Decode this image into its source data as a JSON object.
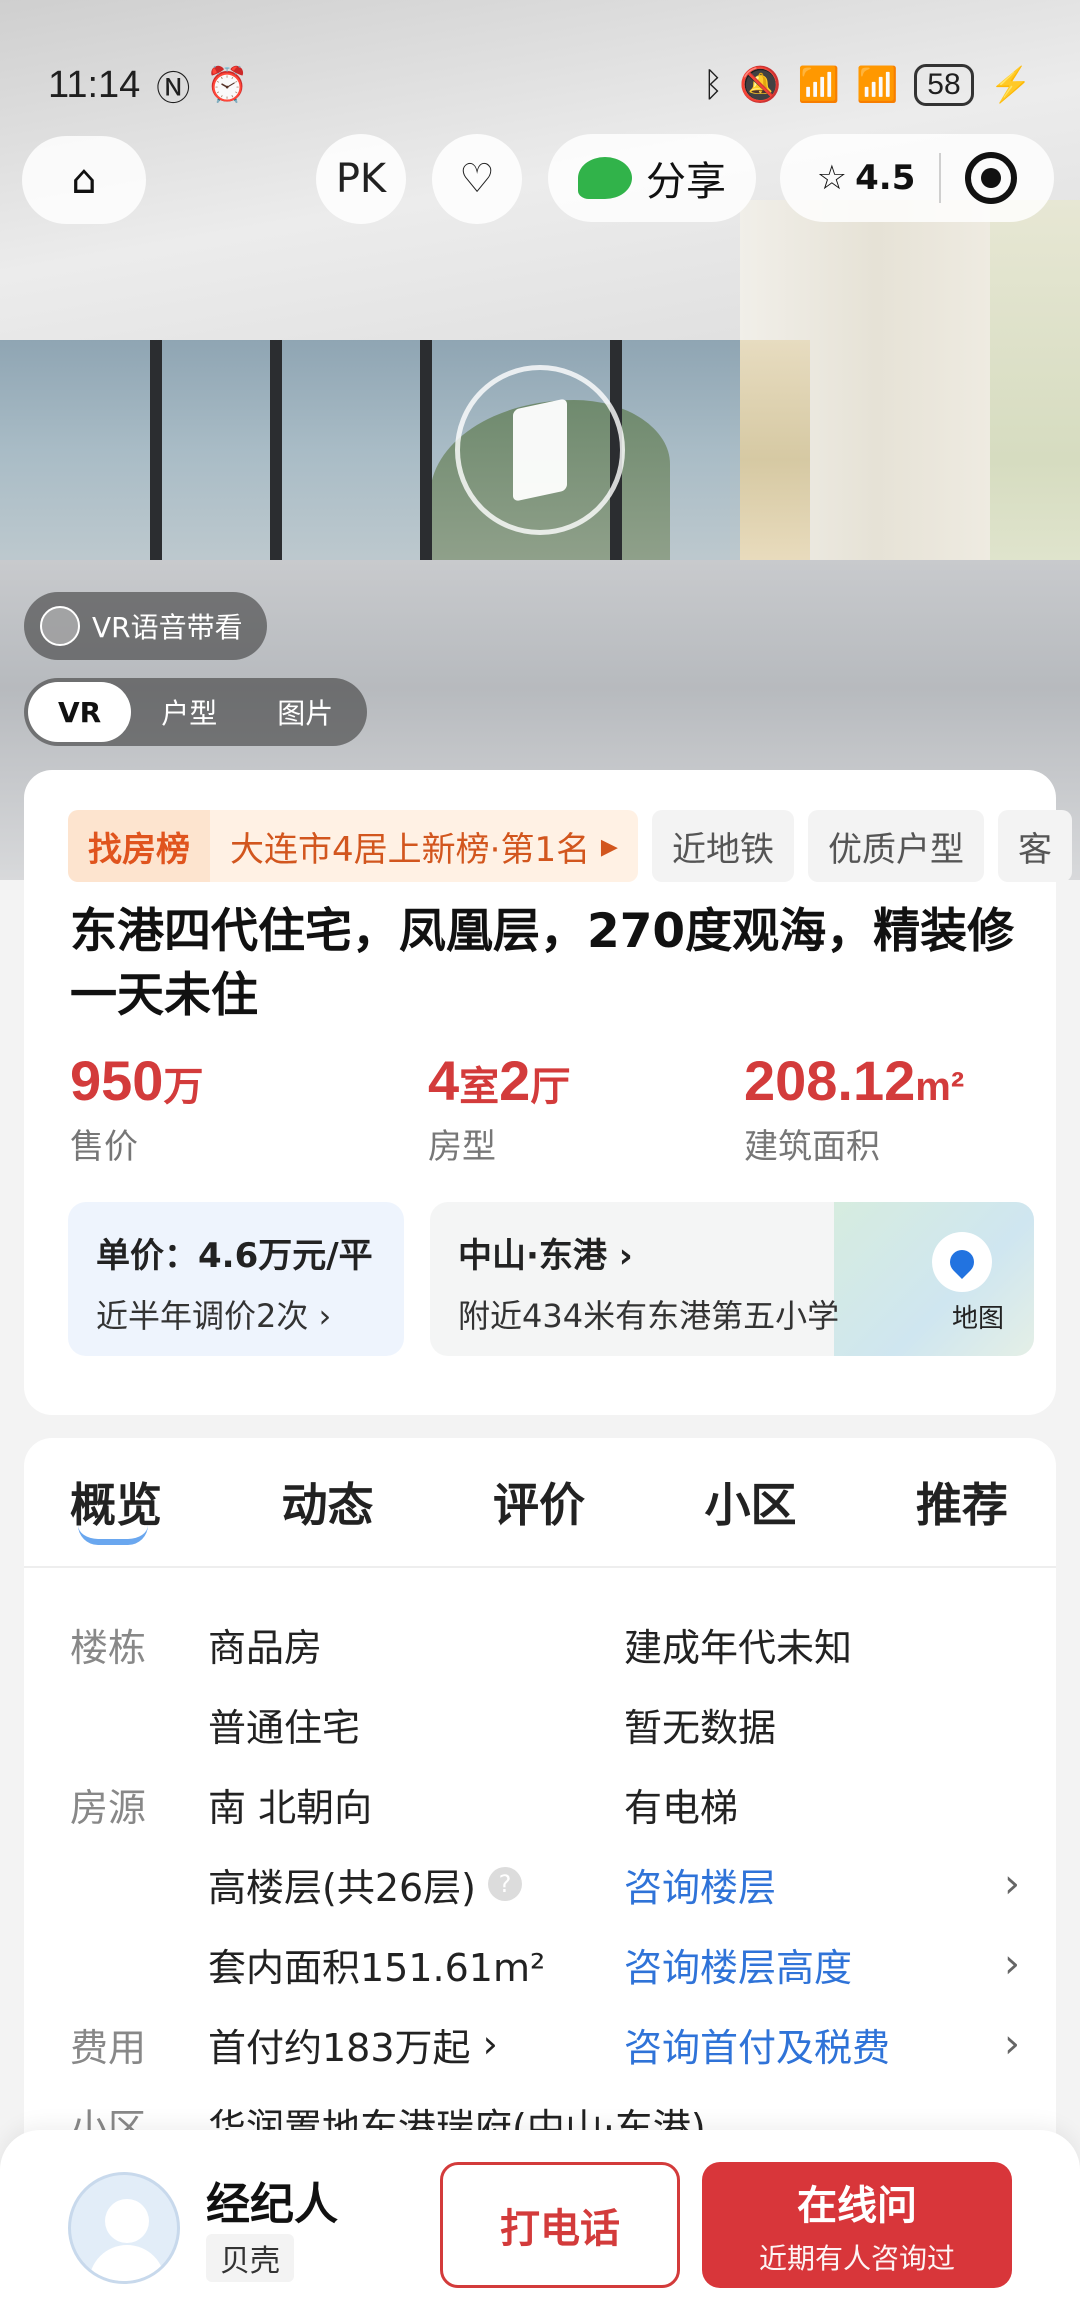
{
  "status_bar": {
    "time": "11:14",
    "battery": "58"
  },
  "toolbar": {
    "pk_label": "PK",
    "share_label": "分享",
    "rating": "4.5"
  },
  "media": {
    "vr_voice_label": "VR语音带看",
    "tabs": [
      "VR",
      "户型",
      "图片"
    ],
    "active_tab": "VR"
  },
  "tags": {
    "rank_badge": "找房榜",
    "rank_text": "大连市4居上新榜·第1名",
    "items": [
      "近地铁",
      "优质户型",
      "客"
    ]
  },
  "listing": {
    "title": "东港四代住宅，凤凰层，270度观海，精装修一天未住",
    "price": {
      "value": "950",
      "unit": "万",
      "label": "售价"
    },
    "layout": {
      "a": "4",
      "b": "室",
      "c": "2",
      "d": "厅",
      "label": "房型"
    },
    "area": {
      "value": "208.12",
      "unit": "m²",
      "label": "建筑面积"
    },
    "unit_price": "单价：4.6万元/平",
    "price_change": "近半年调价2次",
    "location": "中山·东港",
    "nearby": "附近434米有东港第五小学",
    "map_label": "地图"
  },
  "detail_tabs": [
    "概览",
    "动态",
    "评价",
    "小区",
    "推荐"
  ],
  "detail_rows": [
    {
      "key": "楼栋",
      "c1": "商品房",
      "c2": "建成年代未知"
    },
    {
      "key": "",
      "c1": "普通住宅",
      "c2": "暂无数据"
    },
    {
      "key": "房源",
      "c1": "南 北朝向",
      "c2": "有电梯"
    },
    {
      "key": "",
      "c1": "高楼层(共26层)",
      "c2": "咨询楼层"
    },
    {
      "key": "",
      "c1": "套内面积151.61m²",
      "c2": "咨询楼层高度"
    },
    {
      "key": "费用",
      "c1": "首付约183万起",
      "c2": "咨询首付及税费"
    },
    {
      "key": "小区",
      "c1": "华润置地东港瑞府(中山·东港)",
      "c2": ""
    }
  ],
  "bottom_bar": {
    "agent_label": "经纪人",
    "brand": "贝壳",
    "call_label": "打电话",
    "online_label": "在线问",
    "online_sub": "近期有人咨询过"
  },
  "colors": {
    "accent_red": "#d33b3b",
    "link_blue": "#2f73d8",
    "rank_orange": "#e0541e"
  }
}
